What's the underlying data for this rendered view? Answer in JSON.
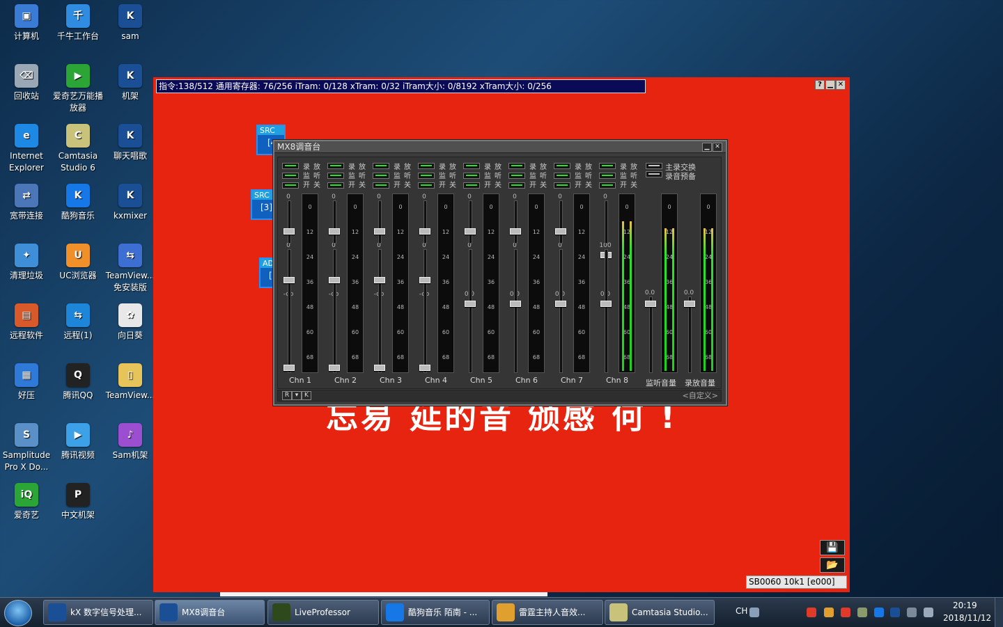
{
  "desktop": {
    "icons": [
      {
        "label": "计算机",
        "color": "#3a7bd5",
        "glyph": "▣"
      },
      {
        "label": "千牛工作台",
        "color": "#2f8ce0",
        "glyph": "千"
      },
      {
        "label": "sam",
        "color": "#1b4f95",
        "glyph": "K"
      },
      {
        "label": "回收站",
        "color": "#9aa7b4",
        "glyph": "⌫"
      },
      {
        "label": "爱奇艺万能播放器",
        "color": "#2aa536",
        "glyph": "▶"
      },
      {
        "label": "机架",
        "color": "#1b4f95",
        "glyph": "K"
      },
      {
        "label": "Internet Explorer",
        "color": "#1e88e5",
        "glyph": "e"
      },
      {
        "label": "Camtasia Studio 6",
        "color": "#c9c27a",
        "glyph": "C"
      },
      {
        "label": "聊天唱歌",
        "color": "#1b4f95",
        "glyph": "K"
      },
      {
        "label": "宽带连接",
        "color": "#4b76b8",
        "glyph": "⇄"
      },
      {
        "label": "酷狗音乐",
        "color": "#1677e6",
        "glyph": "K"
      },
      {
        "label": "kxmixer",
        "color": "#1b4f95",
        "glyph": "K"
      },
      {
        "label": "清理垃圾",
        "color": "#3f8fd8",
        "glyph": "✦"
      },
      {
        "label": "UC浏览器",
        "color": "#f0902a",
        "glyph": "U"
      },
      {
        "label": "TeamView... 免安装版",
        "color": "#3c6fd1",
        "glyph": "⇆"
      },
      {
        "label": "远程软件",
        "color": "#d85a2a",
        "glyph": "▤"
      },
      {
        "label": "远程(1)",
        "color": "#1d86d9",
        "glyph": "⇆"
      },
      {
        "label": "向日葵",
        "color": "#e8e8e8",
        "glyph": "✿"
      },
      {
        "label": "好压",
        "color": "#2f7ad8",
        "glyph": "▦"
      },
      {
        "label": "腾讯QQ",
        "color": "#222222",
        "glyph": "Q"
      },
      {
        "label": "TeamView...",
        "color": "#e6c45a",
        "glyph": "▯"
      },
      {
        "label": "Samplitude Pro X Do...",
        "color": "#5a8fc8",
        "glyph": "S"
      },
      {
        "label": "腾讯视频",
        "color": "#3da1e8",
        "glyph": "▶"
      },
      {
        "label": "Sam机架",
        "color": "#9b4fd0",
        "glyph": "♪"
      },
      {
        "label": "爱奇艺",
        "color": "#2aa536",
        "glyph": "iQ"
      },
      {
        "label": "中文机架",
        "color": "#222222",
        "glyph": "P"
      }
    ]
  },
  "red_window": {
    "status": "指令:138/512 通用寄存器: 76/256 iTram: 0/128 xTram: 0/32 iTram大小: 0/8192 xTram大小: 0/256",
    "help_btn": "?",
    "min_btn": "▁",
    "close_btn": "✕",
    "side_boxes": [
      {
        "header": "SRC",
        "value": "[4"
      },
      {
        "header": "SRC",
        "value": "[3]"
      },
      {
        "header": "AD",
        "value": "["
      }
    ],
    "background_text": "忘易 延的音 颁感 何 !",
    "save_icon": "💾",
    "open_icon": "📂",
    "sb_label": "SB0060 10k1 [e000]"
  },
  "mixer": {
    "title": "MX8调音台",
    "min_btn": "▁",
    "close_btn": "✕",
    "switch_labels": {
      "row1": [
        "录",
        "放"
      ],
      "row2": [
        "监",
        "听"
      ],
      "row3": [
        "开",
        "关"
      ]
    },
    "meter_ticks": [
      "0",
      "12",
      "24",
      "36",
      "48",
      "60",
      "68"
    ],
    "fader_top_label": "0",
    "fader_mid_label": "0",
    "fader_low_label": "-oo",
    "channels": [
      {
        "name": "Chn 1",
        "vol": "-oo",
        "level": 0
      },
      {
        "name": "Chn 2",
        "vol": "-oo",
        "level": 0
      },
      {
        "name": "Chn 3",
        "vol": "-oo",
        "level": 0
      },
      {
        "name": "Chn 4",
        "vol": "-oo",
        "level": 0
      },
      {
        "name": "Chn 5",
        "vol": "0.0",
        "level": 0
      },
      {
        "name": "Chn 6",
        "vol": "0.0",
        "level": 0
      },
      {
        "name": "Chn 7",
        "vol": "0.0",
        "level": 0
      },
      {
        "name": "Chn 8",
        "vol": "0.0",
        "mid": "100",
        "level": 0.86
      }
    ],
    "master": {
      "labels": [
        "主录交换",
        "录音预备"
      ],
      "monitor": {
        "name": "监听音量",
        "vol": "0.0",
        "level": 0.82
      },
      "record": {
        "name": "录放音量",
        "vol": "0.0",
        "level": 0.82
      }
    },
    "footer_btns": [
      "R",
      "▾",
      "K"
    ],
    "preset": "<自定义>"
  },
  "taskbar": {
    "items": [
      {
        "label": "kX 数字信号处理...",
        "color": "#1b4f95"
      },
      {
        "label": "MX8调音台",
        "color": "#1b4f95"
      },
      {
        "label": "LiveProfessor",
        "color": "#2e4a1c"
      },
      {
        "label": "酷狗音乐 陌南 - ...",
        "color": "#1677e6"
      },
      {
        "label": "雷霆主持人音效...",
        "color": "#e0a030"
      },
      {
        "label": "Camtasia Studio...",
        "color": "#c9c27a"
      }
    ],
    "lang": "CH",
    "time": "20:19",
    "date": "2018/11/12"
  }
}
